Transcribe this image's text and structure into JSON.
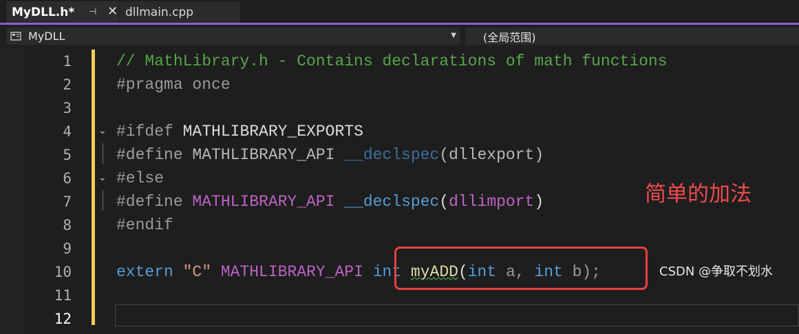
{
  "tabs": {
    "active": {
      "title": "MyDLL.h*",
      "pin_icon": "pin-icon",
      "close_icon": "close-icon"
    },
    "inactive": {
      "title": "dllmain.cpp"
    }
  },
  "navbar": {
    "project": "MyDLL",
    "scope": "(全局范围)"
  },
  "editor": {
    "line_numbers": [
      "1",
      "2",
      "3",
      "4",
      "5",
      "6",
      "7",
      "8",
      "9",
      "10",
      "11",
      "12"
    ],
    "current_line": "12",
    "code": {
      "l1": "// MathLibrary.h - Contains declarations of math functions",
      "l2_a": "#pragma",
      "l2_b": " once",
      "l4_a": "#ifdef",
      "l4_b": " MATHLIBRARY_EXPORTS",
      "l5_a": "#define",
      "l5_b": " MATHLIBRARY_API ",
      "l5_c": "__declspec",
      "l5_d": "(dllexport)",
      "l6": "#else",
      "l7_a": "#define",
      "l7_b": " MATHLIBRARY_API",
      "l7_c": " __declspec",
      "l7_d": "(",
      "l7_e": "dllimport",
      "l7_f": ")",
      "l8": "#endif",
      "l10_a": "extern",
      "l10_b": " \"C\"",
      "l10_c": " MATHLIBRARY_API ",
      "l10_d": "int",
      "l10_e": " ",
      "l10_f": "myADD",
      "l10_g": "(",
      "l10_h": "int",
      "l10_i": " a, ",
      "l10_j": "int",
      "l10_k": " b);"
    }
  },
  "annotation": "简单的加法",
  "watermark": "CSDN @争取不划水"
}
